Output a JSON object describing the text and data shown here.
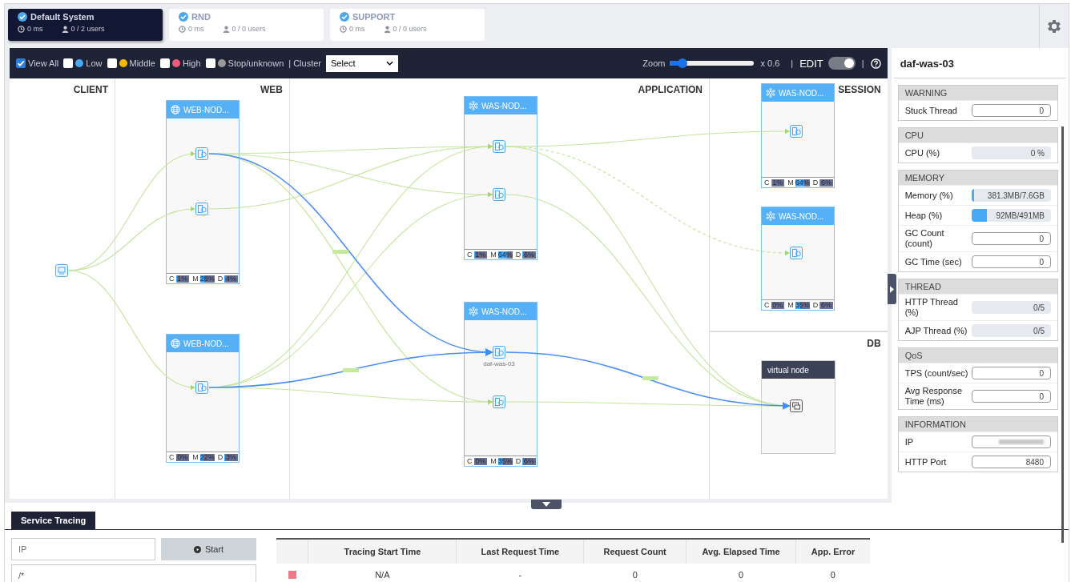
{
  "system_tabs": [
    {
      "label": "Default System",
      "time": "0 ms",
      "users": "0 / 2 users",
      "selected": true
    },
    {
      "label": "RND",
      "time": "0 ms",
      "users": "0 / 0 users",
      "selected": false
    },
    {
      "label": "SUPPORT",
      "time": "0 ms",
      "users": "0 / 0 users",
      "selected": false
    }
  ],
  "toolbar": {
    "filters": [
      {
        "label": "View All",
        "checked": true
      },
      {
        "label": "Low",
        "checked": false,
        "color": "#4aa8f0"
      },
      {
        "label": "Middle",
        "checked": false,
        "color": "#f5b800"
      },
      {
        "label": "High",
        "checked": false,
        "color": "#ee5c7a"
      },
      {
        "label": "Stop/unknown",
        "checked": false,
        "color": "#9a9a9a"
      }
    ],
    "cluster_label": "| Cluster",
    "cluster_select": "Select",
    "zoom_label": "Zoom",
    "zoom": {
      "level": 0.15
    },
    "zoom_value": "x 0.6",
    "separator": "|",
    "edit_label": "EDIT",
    "edit_toggle": {
      "on": true
    },
    "separator_2": "|"
  },
  "columns": [
    "CLIENT",
    "WEB",
    "APPLICATION",
    "SESSION",
    "DB"
  ],
  "nodes": [
    {
      "kind": "web",
      "title": "WEB-NOD...",
      "metrics": [
        {
          "label": "C",
          "value": "1%",
          "level": 0.01
        },
        {
          "label": "M",
          "value": "28%",
          "level": 0.28
        },
        {
          "label": "D",
          "value": "4%",
          "level": 0.04
        }
      ]
    },
    {
      "kind": "web",
      "title": "WEB-NOD...",
      "metrics": [
        {
          "label": "C",
          "value": "0%",
          "level": 0
        },
        {
          "label": "M",
          "value": "22%",
          "level": 0.22
        },
        {
          "label": "D",
          "value": "3%",
          "level": 0.03
        }
      ]
    },
    {
      "kind": "was",
      "title": "WAS-NOD...",
      "metrics": [
        {
          "label": "C",
          "value": "1%",
          "level": 0.01
        },
        {
          "label": "M",
          "value": "64%",
          "level": 0.64
        },
        {
          "label": "D",
          "value": "6%",
          "level": 0.06
        }
      ]
    },
    {
      "kind": "was",
      "title": "WAS-NOD...",
      "caption": "daf-was-03",
      "metrics": [
        {
          "label": "C",
          "value": "0%",
          "level": 0
        },
        {
          "label": "M",
          "value": "35%",
          "level": 0.35
        },
        {
          "label": "D",
          "value": "6%",
          "level": 0.06
        }
      ]
    },
    {
      "kind": "was",
      "title": "WAS-NOD...",
      "metrics": [
        {
          "label": "C",
          "value": "1%",
          "level": 0.01
        },
        {
          "label": "M",
          "value": "64%",
          "level": 0.64
        },
        {
          "label": "D",
          "value": "6%",
          "level": 0.06
        }
      ]
    },
    {
      "kind": "was",
      "title": "WAS-NOD...",
      "metrics": [
        {
          "label": "C",
          "value": "0%",
          "level": 0
        },
        {
          "label": "M",
          "value": "35%",
          "level": 0.35
        },
        {
          "label": "D",
          "value": "6%",
          "level": 0.06
        }
      ]
    },
    {
      "kind": "virtual",
      "title": "virtual node"
    }
  ],
  "detail_panel": {
    "title": "daf-was-03",
    "sections": [
      {
        "title": "WARNING",
        "rows": [
          {
            "kind": "field",
            "label": "Stuck Thread",
            "value": "0"
          }
        ]
      },
      {
        "title": "CPU",
        "rows": [
          {
            "kind": "gauge",
            "label": "CPU (%)",
            "value": "0 %",
            "level": 0
          }
        ]
      },
      {
        "title": "MEMORY",
        "rows": [
          {
            "kind": "gauge",
            "label": "Memory (%)",
            "value": "381.3MB/7.6GB",
            "level": 0.03
          },
          {
            "kind": "gauge",
            "label": "Heap (%)",
            "value": "92MB/491MB",
            "level": 0.19
          },
          {
            "kind": "field",
            "label": "GC Count (count)",
            "value": "0"
          },
          {
            "kind": "field",
            "label": "GC Time (sec)",
            "value": "0"
          }
        ]
      },
      {
        "title": "THREAD",
        "rows": [
          {
            "kind": "gauge",
            "label": "HTTP Thread (%)",
            "value": "0/5",
            "level": 0
          },
          {
            "kind": "gauge",
            "label": "AJP Thread (%)",
            "value": "0/5",
            "level": 0
          }
        ]
      },
      {
        "title": "QoS",
        "rows": [
          {
            "kind": "field",
            "label": "TPS (count/sec)",
            "value": "0"
          },
          {
            "kind": "field",
            "label": "Avg Response Time (ms)",
            "value": "0"
          }
        ]
      },
      {
        "title": "INFORMATION",
        "rows": [
          {
            "kind": "redacted",
            "label": "IP"
          },
          {
            "kind": "field",
            "label": "HTTP Port",
            "value": "8480"
          }
        ]
      }
    ]
  },
  "service_tracing": {
    "tab": "Service Tracing",
    "ip_placeholder": "IP",
    "start_button": "Start",
    "url_value": "/*",
    "table": {
      "columns": [
        "Tracing Start Time",
        "Last Request Time",
        "Request Count",
        "Avg. Elapsed Time",
        "App. Error"
      ],
      "rows": [
        {
          "color": "#f07b86",
          "cells": [
            "N/A",
            "-",
            "0",
            "0",
            "0"
          ]
        }
      ]
    }
  }
}
